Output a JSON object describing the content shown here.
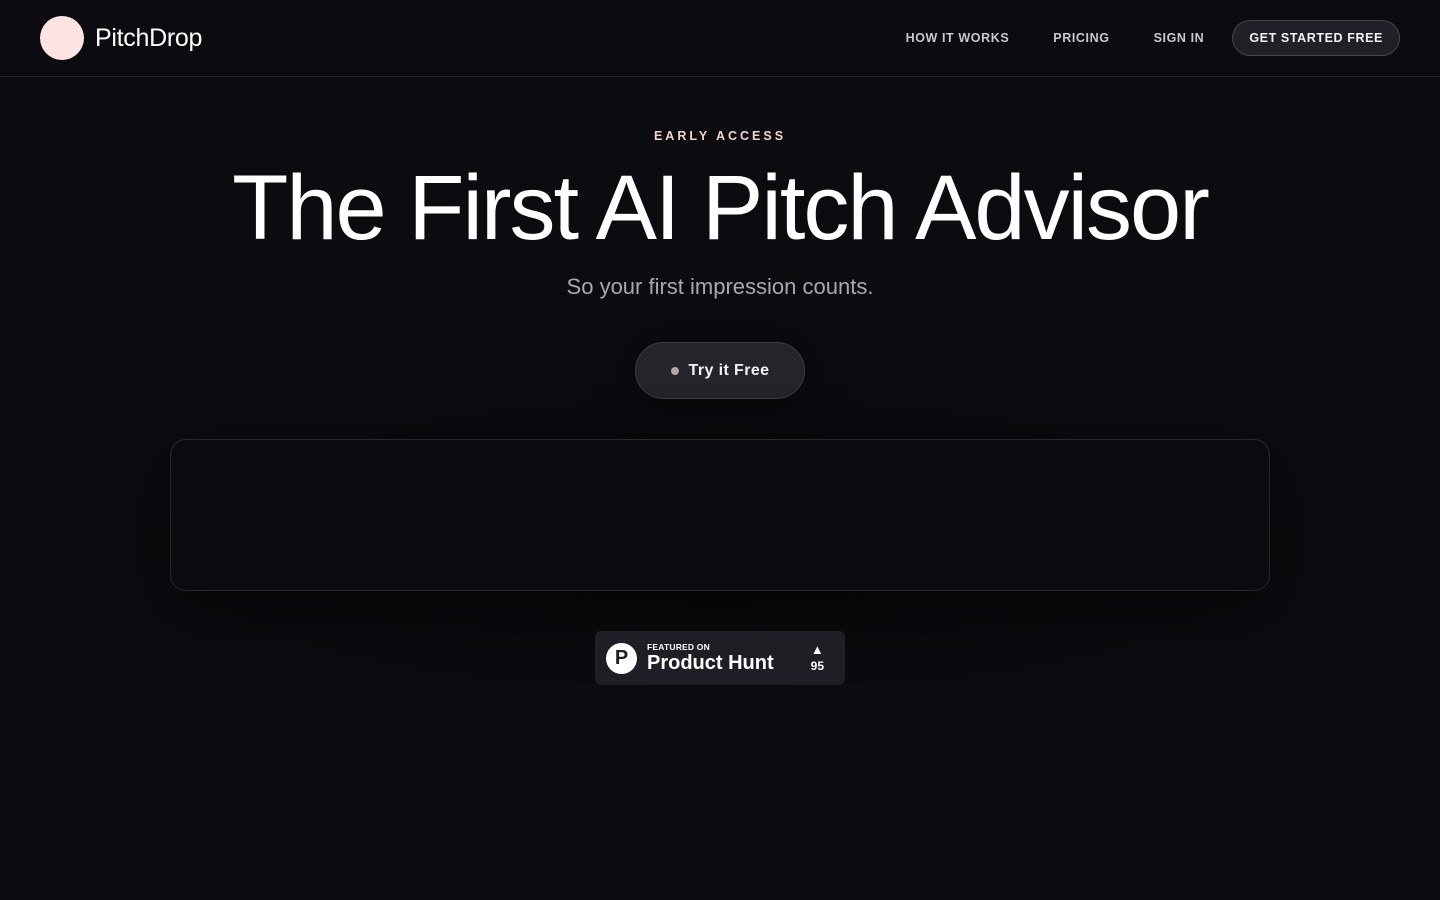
{
  "brand": {
    "name": "PitchDrop",
    "logo_color": "#fde3e1"
  },
  "nav": {
    "links": [
      "HOW IT WORKS",
      "PRICING",
      "SIGN IN"
    ],
    "cta_label": "GET STARTED FREE"
  },
  "hero": {
    "eyebrow": "EARLY ACCESS",
    "headline": "The First AI Pitch Advisor",
    "subhead": "So your first impression counts.",
    "cta_label": "Try it Free"
  },
  "product_hunt": {
    "featured_label": "FEATURED ON",
    "name": "Product Hunt",
    "logo_letter": "P",
    "upvote_icon": "upvote-triangle-icon",
    "votes": "95"
  },
  "colors": {
    "background": "#0c0b10",
    "accent": "#f0d5cf",
    "button_bg": "#25242b"
  }
}
